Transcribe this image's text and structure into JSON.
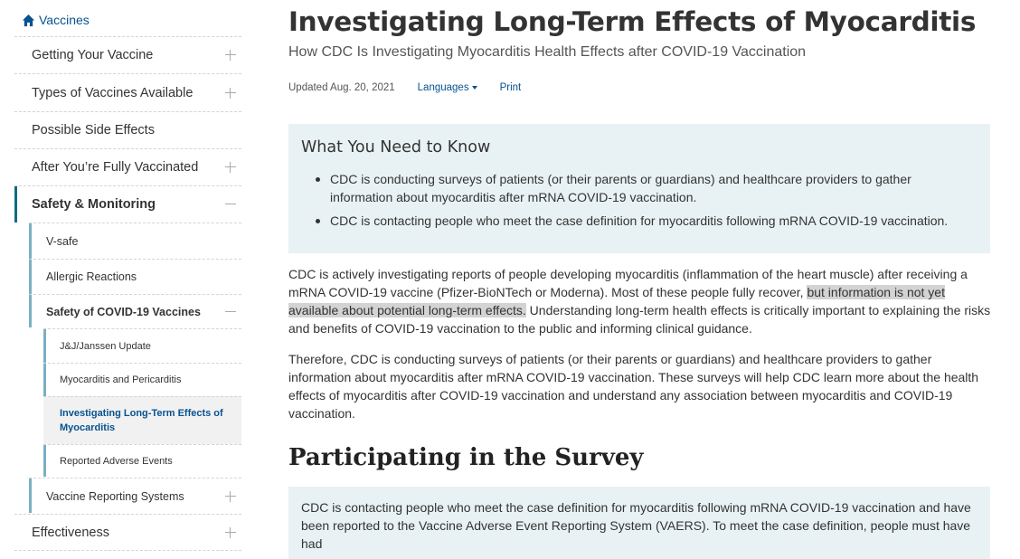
{
  "sidebar": {
    "home_label": "Vaccines",
    "items": [
      {
        "label": "Getting Your Vaccine",
        "toggle": "+"
      },
      {
        "label": "Types of Vaccines Available",
        "toggle": "+"
      },
      {
        "label": "Possible Side Effects",
        "toggle": ""
      },
      {
        "label": "After You’re Fully Vaccinated",
        "toggle": "+"
      },
      {
        "label": "Safety & Monitoring",
        "toggle": "−"
      },
      {
        "label": "V-safe",
        "toggle": ""
      },
      {
        "label": "Allergic Reactions",
        "toggle": ""
      },
      {
        "label": "Safety of COVID-19 Vaccines",
        "toggle": "−"
      },
      {
        "label": "J&J/Janssen Update",
        "toggle": ""
      },
      {
        "label": "Myocarditis and Pericarditis",
        "toggle": ""
      },
      {
        "label": "Investigating Long-Term Effects of Myocarditis",
        "toggle": ""
      },
      {
        "label": "Reported Adverse Events",
        "toggle": ""
      },
      {
        "label": "Vaccine Reporting Systems",
        "toggle": "+"
      },
      {
        "label": "Effectiveness",
        "toggle": "+"
      }
    ]
  },
  "page": {
    "title": "Investigating Long-Term Effects of Myocarditis",
    "subtitle": "How CDC Is Investigating Myocarditis Health Effects after COVID-19 Vaccination",
    "updated": "Updated Aug. 20, 2021",
    "languages_label": "Languages",
    "print_label": "Print"
  },
  "callout": {
    "heading": "What You Need to Know",
    "bullets": [
      "CDC is conducting surveys of patients (or their parents or guardians) and healthcare providers to gather information about myocarditis after mRNA COVID-19 vaccination.",
      "CDC is contacting people who meet the case definition for myocarditis following mRNA COVID-19 vaccination."
    ]
  },
  "body": {
    "p1_before": "CDC is actively investigating reports of people developing myocarditis (inflammation of the heart muscle) after receiving a mRNA COVID-19 vaccine (Pfizer-BioNTech or Moderna). Most of these people fully recover, ",
    "p1_highlight": "but information is not yet available about potential long-term effects.",
    "p1_after": " Understanding long-term health effects is critically important to explaining the risks and benefits of COVID-19 vaccination to the public and informing clinical guidance.",
    "p2": "Therefore, CDC is conducting surveys of patients (or their parents or guardians) and healthcare providers to gather information about myocarditis after mRNA COVID-19 vaccination. These surveys will help CDC learn more about the health effects of myocarditis after COVID-19 vaccination and understand any association between myocarditis and COVID-19 vaccination.",
    "section_heading": "Participating in the Survey",
    "callout2": "CDC is contacting people who meet the case definition for myocarditis following mRNA COVID-19 vaccination and have been reported to the Vaccine Adverse Event Reporting System (VAERS). To meet the case definition, people must have had"
  },
  "colors": {
    "link": "#075290",
    "callout_bg": "#e8f2f4",
    "nav_bar_dark": "#0c6c86",
    "nav_bar_light": "#7ab0c3",
    "highlight": "#d3d3d3"
  }
}
